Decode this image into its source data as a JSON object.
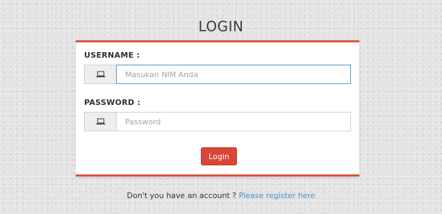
{
  "page": {
    "title": "LOGIN"
  },
  "form": {
    "username": {
      "label": "USERNAME :",
      "placeholder": "Masukan NIM Anda",
      "icon": "laptop-icon"
    },
    "password": {
      "label": "PASSWORD :",
      "placeholder": "Password",
      "icon": "laptop-icon"
    },
    "submit_label": "Login"
  },
  "footer": {
    "prompt": "Don't you have an account ? ",
    "link_text": "Please register here"
  },
  "colors": {
    "accent": "#d9523a",
    "button": "#d9463a",
    "link": "#4a90c8",
    "focus_border": "#5ea0c6"
  }
}
